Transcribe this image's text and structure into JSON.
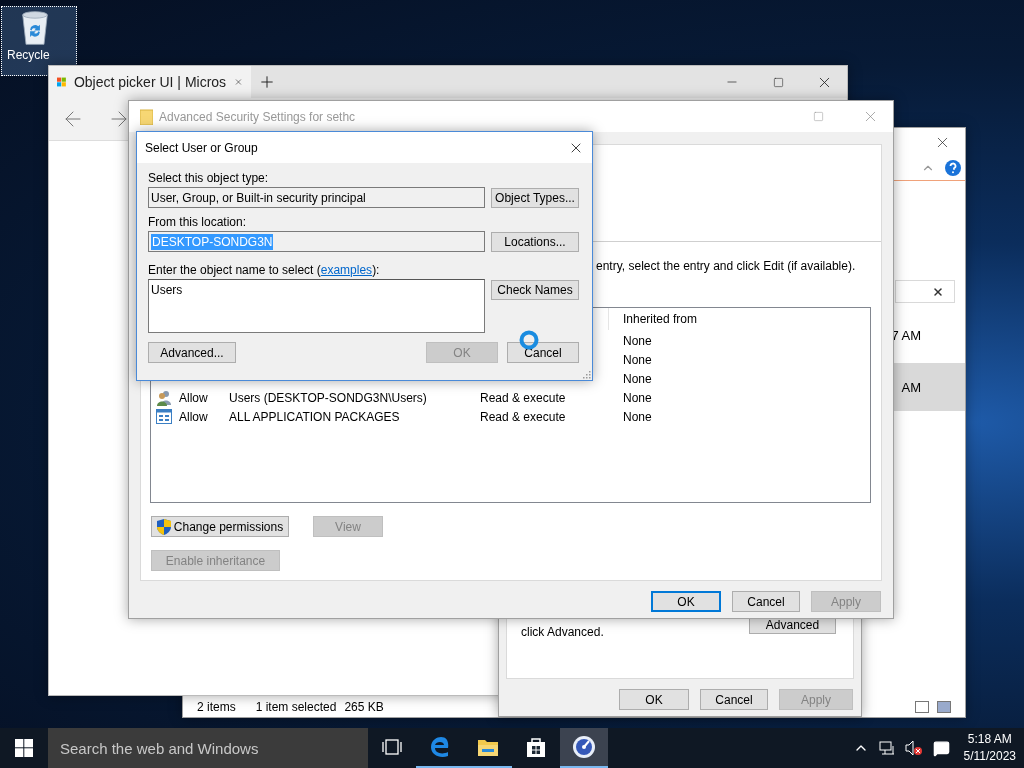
{
  "desktop": {
    "icons": [
      {
        "label": "Recycle",
        "selected": true
      }
    ]
  },
  "browser": {
    "tabs": [
      {
        "title": "Object picker UI | Micros",
        "selected": true
      }
    ]
  },
  "explorer": {
    "rows": [
      {
        "modified": "7 AM",
        "selected": false
      },
      {
        "modified": "AM",
        "selected": true
      }
    ],
    "status_bar": {
      "item_count": "2 items",
      "selection": "1 item selected",
      "size": "265 KB"
    }
  },
  "properties": {
    "note_lines": [
      "click Advanced."
    ],
    "advanced_button": "Advanced",
    "buttons": [
      {
        "label": "OK",
        "disabled": false
      },
      {
        "label": "Cancel",
        "disabled": false
      },
      {
        "label": "Apply",
        "disabled": true
      }
    ]
  },
  "advanced_security": {
    "title": "Advanced Security Settings for sethc",
    "active": false,
    "instruction": "entry, select the entry and click Edit (if available).",
    "columns": [
      {
        "label": "Inherited from"
      }
    ],
    "entries": [
      {
        "inherited_from": "None"
      },
      {
        "inherited_from": "None"
      },
      {
        "inherited_from": "None"
      },
      {
        "kind": "users",
        "type": "Allow",
        "principal": "Users (DESKTOP-SONDG3N\\Users)",
        "access": "Read & execute",
        "inherited_from": "None"
      },
      {
        "kind": "packages",
        "type": "Allow",
        "principal": "ALL APPLICATION PACKAGES",
        "access": "Read & execute",
        "inherited_from": "None"
      }
    ],
    "actions": [
      {
        "label": "Change permissions",
        "shield": true,
        "disabled": false
      },
      {
        "label": "View",
        "shield": false,
        "disabled": true
      }
    ],
    "inheritance_button": {
      "label": "Enable inheritance",
      "disabled": true
    },
    "buttons": [
      {
        "label": "OK",
        "disabled": false,
        "default": true
      },
      {
        "label": "Cancel",
        "disabled": false,
        "default": false
      },
      {
        "label": "Apply",
        "disabled": true,
        "default": false
      }
    ]
  },
  "select_dialog": {
    "title": "Select User or Group",
    "object_type_label": "Select this object type:",
    "object_type": "User, Group, or Built-in security principal",
    "object_types_button": "Object Types...",
    "location_label": "From this location:",
    "location": {
      "value": "DESKTOP-SONDG3N",
      "selected": true
    },
    "locations_button": "Locations...",
    "name_label": "Enter the object name to select (",
    "examples_link": "examples",
    "name_label_end": "):",
    "names": "Users",
    "check_names_button": "Check Names",
    "advanced_button": "Advanced...",
    "buttons": [
      {
        "label": "OK",
        "disabled": true
      },
      {
        "label": "Cancel",
        "disabled": false
      }
    ]
  },
  "taskbar": {
    "search_placeholder": "Search the web and Windows",
    "apps": [
      {
        "running": false,
        "selected": false
      },
      {
        "running": true,
        "selected": false
      },
      {
        "running": true,
        "selected": false
      },
      {
        "running": false,
        "selected": false
      },
      {
        "running": true,
        "selected": true
      }
    ],
    "clock": {
      "time": "5:18 AM",
      "date": "5/11/2023"
    }
  }
}
